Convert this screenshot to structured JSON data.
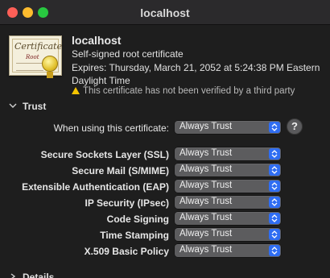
{
  "window": {
    "title": "localhost"
  },
  "certificate": {
    "icon_name": "certificate-icon",
    "icon_text": "Certificate",
    "icon_subtext": "Root",
    "name": "localhost",
    "kind": "Self-signed root certificate",
    "expires": "Expires: Thursday, March 21, 2052 at 5:24:38 PM Eastern Daylight Time",
    "warning": "This certificate has not been verified by a third party"
  },
  "trust": {
    "section_label": "Trust",
    "when_using_label": "When using this certificate:",
    "when_using_value": "Always Trust",
    "help_label": "?",
    "policies": [
      {
        "label": "Secure Sockets Layer (SSL)",
        "value": "Always Trust"
      },
      {
        "label": "Secure Mail (S/MIME)",
        "value": "Always Trust"
      },
      {
        "label": "Extensible Authentication (EAP)",
        "value": "Always Trust"
      },
      {
        "label": "IP Security (IPsec)",
        "value": "Always Trust"
      },
      {
        "label": "Code Signing",
        "value": "Always Trust"
      },
      {
        "label": "Time Stamping",
        "value": "Always Trust"
      },
      {
        "label": "X.509 Basic Policy",
        "value": "Always Trust"
      }
    ]
  },
  "details": {
    "section_label": "Details"
  },
  "colors": {
    "accent": "#2f6df2",
    "warning": "#f5c400"
  }
}
